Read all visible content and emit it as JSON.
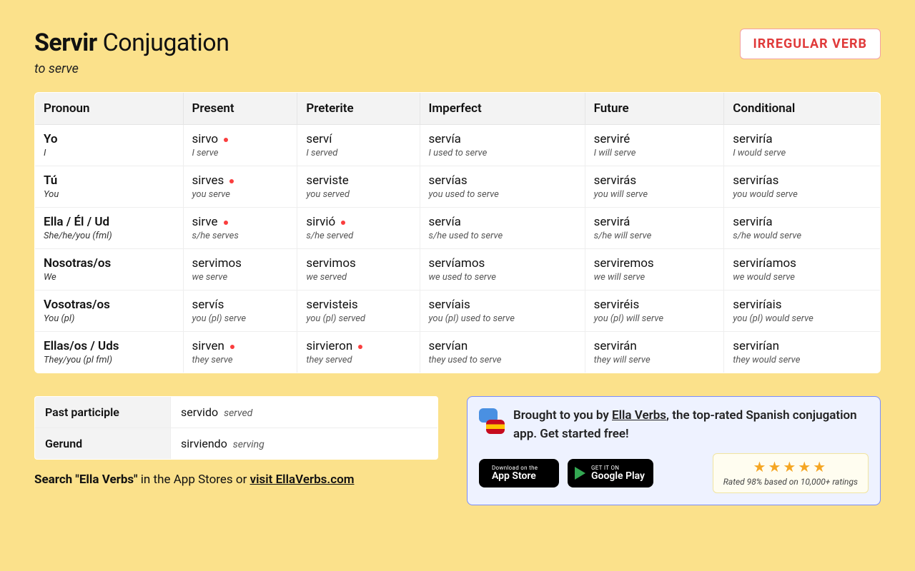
{
  "title": {
    "verb": "Servir",
    "suffix": "Conjugation",
    "meaning": "to serve"
  },
  "badge": "IRREGULAR VERB",
  "columns": [
    "Pronoun",
    "Present",
    "Preterite",
    "Imperfect",
    "Future",
    "Conditional"
  ],
  "rows": [
    {
      "pronoun": "Yo",
      "pronoun_sub": "I",
      "cells": [
        {
          "form": "sirvo",
          "sub": "I serve",
          "dot": true
        },
        {
          "form": "serví",
          "sub": "I served",
          "dot": false
        },
        {
          "form": "servía",
          "sub": "I used to serve",
          "dot": false
        },
        {
          "form": "serviré",
          "sub": "I will serve",
          "dot": false
        },
        {
          "form": "serviría",
          "sub": "I would serve",
          "dot": false
        }
      ]
    },
    {
      "pronoun": "Tú",
      "pronoun_sub": "You",
      "cells": [
        {
          "form": "sirves",
          "sub": "you serve",
          "dot": true
        },
        {
          "form": "serviste",
          "sub": "you served",
          "dot": false
        },
        {
          "form": "servías",
          "sub": "you used to serve",
          "dot": false
        },
        {
          "form": "servirás",
          "sub": "you will serve",
          "dot": false
        },
        {
          "form": "servirías",
          "sub": "you would serve",
          "dot": false
        }
      ]
    },
    {
      "pronoun": "Ella / Él / Ud",
      "pronoun_sub": "She/he/you (fml)",
      "cells": [
        {
          "form": "sirve",
          "sub": "s/he serves",
          "dot": true
        },
        {
          "form": "sirvió",
          "sub": "s/he served",
          "dot": true
        },
        {
          "form": "servía",
          "sub": "s/he used to serve",
          "dot": false
        },
        {
          "form": "servirá",
          "sub": "s/he will serve",
          "dot": false
        },
        {
          "form": "serviría",
          "sub": "s/he would serve",
          "dot": false
        }
      ]
    },
    {
      "pronoun": "Nosotras/os",
      "pronoun_sub": "We",
      "cells": [
        {
          "form": "servimos",
          "sub": "we serve",
          "dot": false
        },
        {
          "form": "servimos",
          "sub": "we served",
          "dot": false
        },
        {
          "form": "servíamos",
          "sub": "we used to serve",
          "dot": false
        },
        {
          "form": "serviremos",
          "sub": "we will serve",
          "dot": false
        },
        {
          "form": "serviríamos",
          "sub": "we would serve",
          "dot": false
        }
      ]
    },
    {
      "pronoun": "Vosotras/os",
      "pronoun_sub": "You (pl)",
      "cells": [
        {
          "form": "servís",
          "sub": "you (pl) serve",
          "dot": false
        },
        {
          "form": "servisteis",
          "sub": "you (pl) served",
          "dot": false
        },
        {
          "form": "servíais",
          "sub": "you (pl) used to serve",
          "dot": false
        },
        {
          "form": "serviréis",
          "sub": "you (pl) will serve",
          "dot": false
        },
        {
          "form": "serviríais",
          "sub": "you (pl) would serve",
          "dot": false
        }
      ]
    },
    {
      "pronoun": "Ellas/os / Uds",
      "pronoun_sub": "They/you (pl fml)",
      "cells": [
        {
          "form": "sirven",
          "sub": "they serve",
          "dot": true
        },
        {
          "form": "sirvieron",
          "sub": "they served",
          "dot": true
        },
        {
          "form": "servían",
          "sub": "they used to serve",
          "dot": false
        },
        {
          "form": "servirán",
          "sub": "they will serve",
          "dot": false
        },
        {
          "form": "servirían",
          "sub": "they would serve",
          "dot": false
        }
      ]
    }
  ],
  "participles": [
    {
      "label": "Past participle",
      "form": "servido",
      "sub": "served"
    },
    {
      "label": "Gerund",
      "form": "sirviendo",
      "sub": "serving"
    }
  ],
  "search_line": {
    "prefix": "Search \"Ella Verbs\"",
    "mid": " in the App Stores or ",
    "link": "visit EllaVerbs.com"
  },
  "promo": {
    "text_prefix": "Brought to you by ",
    "link": "Ella Verbs",
    "text_suffix": ", the top-rated Spanish conjugation app. Get started free!",
    "appstore": {
      "l1": "Download on the",
      "l2": "App Store"
    },
    "gplay": {
      "l1": "GET IT ON",
      "l2": "Google Play"
    },
    "rating_sub": "Rated 98% based on 10,000+ ratings"
  }
}
